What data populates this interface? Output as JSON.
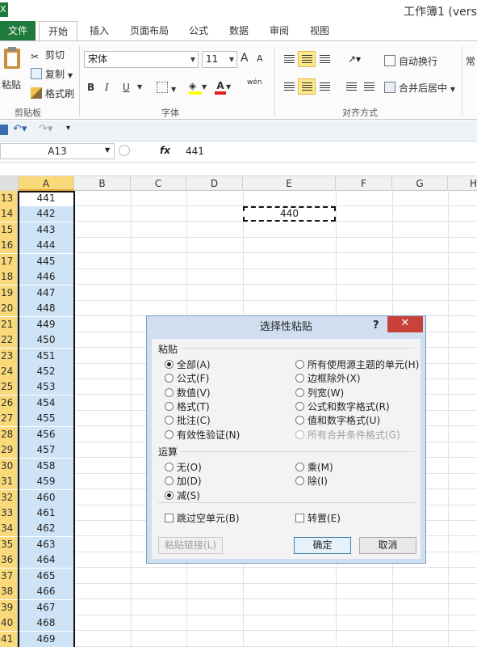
{
  "window": {
    "app_icon_letter": "X",
    "title": "工作簿1 (versi"
  },
  "tabs": [
    "文件",
    "开始",
    "插入",
    "页面布局",
    "公式",
    "数据",
    "审阅",
    "视图"
  ],
  "ribbon": {
    "clipboard": {
      "paste": "粘贴",
      "cut": "剪切",
      "copy": "复制",
      "format_painter": "格式刷",
      "group": "剪贴板"
    },
    "font": {
      "name": "宋体",
      "size": "11",
      "grow": "A",
      "shrink": "A",
      "bold": "B",
      "italic": "I",
      "underline": "U",
      "phonetic": "wén",
      "group": "字体"
    },
    "alignment": {
      "wrap": "自动换行",
      "merge": "合并后居中",
      "group": "对齐方式"
    },
    "number": {
      "format": "常"
    }
  },
  "formula_bar": {
    "name_box": "A13",
    "fx": "fx",
    "value": "441"
  },
  "sheet": {
    "columns": [
      "A",
      "B",
      "C",
      "D",
      "E",
      "F",
      "G",
      "H"
    ],
    "rows": [
      {
        "n": "13",
        "a": "441"
      },
      {
        "n": "14",
        "a": "442"
      },
      {
        "n": "15",
        "a": "443"
      },
      {
        "n": "16",
        "a": "444"
      },
      {
        "n": "17",
        "a": "445"
      },
      {
        "n": "18",
        "a": "446"
      },
      {
        "n": "19",
        "a": "447"
      },
      {
        "n": "20",
        "a": "448"
      },
      {
        "n": "21",
        "a": "449"
      },
      {
        "n": "22",
        "a": "450"
      },
      {
        "n": "23",
        "a": "451"
      },
      {
        "n": "24",
        "a": "452"
      },
      {
        "n": "25",
        "a": "453"
      },
      {
        "n": "26",
        "a": "454"
      },
      {
        "n": "27",
        "a": "455"
      },
      {
        "n": "28",
        "a": "456"
      },
      {
        "n": "29",
        "a": "457"
      },
      {
        "n": "30",
        "a": "458"
      },
      {
        "n": "31",
        "a": "459"
      },
      {
        "n": "32",
        "a": "460"
      },
      {
        "n": "33",
        "a": "461"
      },
      {
        "n": "34",
        "a": "462"
      },
      {
        "n": "35",
        "a": "463"
      },
      {
        "n": "36",
        "a": "464"
      },
      {
        "n": "37",
        "a": "465"
      },
      {
        "n": "38",
        "a": "466"
      },
      {
        "n": "39",
        "a": "467"
      },
      {
        "n": "40",
        "a": "468"
      },
      {
        "n": "41",
        "a": "469"
      }
    ],
    "copied_cell_value": "440"
  },
  "dialog": {
    "title": "选择性粘贴",
    "help": "?",
    "close": "✕",
    "paste_section": "粘贴",
    "paste_options": [
      {
        "label": "全部(A)",
        "selected": true
      },
      {
        "label": "公式(F)",
        "selected": false
      },
      {
        "label": "数值(V)",
        "selected": false
      },
      {
        "label": "格式(T)",
        "selected": false
      },
      {
        "label": "批注(C)",
        "selected": false
      },
      {
        "label": "有效性验证(N)",
        "selected": false
      }
    ],
    "paste_options_right": [
      {
        "label": "所有使用源主题的单元(H)",
        "selected": false
      },
      {
        "label": "边框除外(X)",
        "selected": false
      },
      {
        "label": "列宽(W)",
        "selected": false
      },
      {
        "label": "公式和数字格式(R)",
        "selected": false
      },
      {
        "label": "值和数字格式(U)",
        "selected": false
      },
      {
        "label": "所有合并条件格式(G)",
        "selected": false,
        "disabled": true
      }
    ],
    "operation_section": "运算",
    "op_left": [
      {
        "label": "无(O)",
        "selected": false
      },
      {
        "label": "加(D)",
        "selected": false
      },
      {
        "label": "减(S)",
        "selected": true
      }
    ],
    "op_right": [
      {
        "label": "乘(M)",
        "selected": false
      },
      {
        "label": "除(I)",
        "selected": false
      }
    ],
    "skip_blanks": "跳过空单元(B)",
    "transpose": "转置(E)",
    "paste_link": "粘贴链接(L)",
    "ok": "确定",
    "cancel": "取消"
  }
}
